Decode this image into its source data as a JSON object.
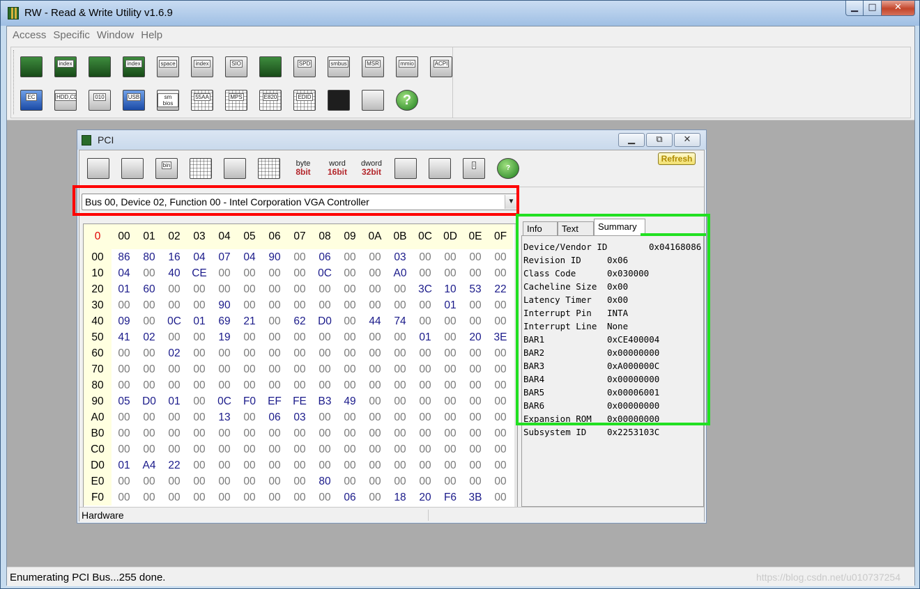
{
  "app": {
    "title": "RW - Read & Write Utility v1.6.9",
    "window_buttons": {
      "minimize": "▁",
      "maximize": "□",
      "close": "✕"
    }
  },
  "menu": [
    "Access",
    "Specific",
    "Window",
    "Help"
  ],
  "toolbar": {
    "row1": [
      {
        "icon": "pci-board-icon",
        "label": ""
      },
      {
        "icon": "pci-index-icon",
        "label": "index"
      },
      {
        "icon": "memory-icon",
        "label": ""
      },
      {
        "icon": "memory-index-icon",
        "label": "index"
      },
      {
        "icon": "io-space-icon",
        "label": "space"
      },
      {
        "icon": "io-index-icon",
        "label": "index"
      },
      {
        "icon": "sio-icon",
        "label": "SIO"
      },
      {
        "icon": "wave-icon",
        "label": ""
      },
      {
        "icon": "spd-icon",
        "label": "SPD"
      },
      {
        "icon": "smbus-icon",
        "label": "smbus"
      },
      {
        "icon": "msr-icon",
        "label": "MSR"
      },
      {
        "icon": "mmio-icon",
        "label": "mmio"
      },
      {
        "icon": "acpi-icon",
        "label": "ACPI"
      }
    ],
    "row2": [
      {
        "icon": "ec-icon",
        "label": "EC"
      },
      {
        "icon": "hdd-cd-icon",
        "label": "HDD,CD"
      },
      {
        "icon": "disk-010-icon",
        "label": "010"
      },
      {
        "icon": "usb-icon",
        "label": "USB"
      },
      {
        "icon": "smbios-icon",
        "label": "sm bios"
      },
      {
        "icon": "55aa-icon",
        "label": "55AA"
      },
      {
        "icon": "mps-icon",
        "label": "MPS"
      },
      {
        "icon": "e820-icon",
        "label": "E820"
      },
      {
        "icon": "edid-icon",
        "label": "EDID"
      },
      {
        "icon": "command-icon",
        "label": ""
      },
      {
        "icon": "device-icon",
        "label": ""
      },
      {
        "icon": "help-icon",
        "label": "?"
      }
    ]
  },
  "pci_window": {
    "title": "PCI",
    "buttons": {
      "minimize": "▁",
      "restore": "⧉",
      "close": "✕"
    },
    "toolbar": [
      {
        "icon": "save-icon",
        "label": ""
      },
      {
        "icon": "save-all-icon",
        "label": ""
      },
      {
        "icon": "save-bin-icon",
        "label": "bin"
      },
      {
        "icon": "load-icon",
        "label": ""
      },
      {
        "icon": "find-icon",
        "label": ""
      },
      {
        "icon": "table-icon",
        "label": ""
      },
      {
        "icon": "byte-8bit-icon",
        "label": "byte",
        "sub": "8bit"
      },
      {
        "icon": "word-16bit-icon",
        "label": "word",
        "sub": "16bit"
      },
      {
        "icon": "dword-32bit-icon",
        "label": "dword",
        "sub": "32bit"
      },
      {
        "icon": "list-icon",
        "label": ""
      },
      {
        "icon": "disabled-icon",
        "label": ""
      },
      {
        "icon": "info-icon",
        "label": "i"
      },
      {
        "icon": "help-icon",
        "label": "?"
      }
    ],
    "refresh_label": "Refresh",
    "device_select": "Bus 00, Device 02, Function 00 - Intel Corporation VGA Controller",
    "hex": {
      "corner": "0",
      "columns": [
        "00",
        "01",
        "02",
        "03",
        "04",
        "05",
        "06",
        "07",
        "08",
        "09",
        "0A",
        "0B",
        "0C",
        "0D",
        "0E",
        "0F"
      ],
      "rows": [
        {
          "addr": "00",
          "bytes": [
            "86",
            "80",
            "16",
            "04",
            "07",
            "04",
            "90",
            "00",
            "06",
            "00",
            "00",
            "03",
            "00",
            "00",
            "00",
            "00"
          ]
        },
        {
          "addr": "10",
          "bytes": [
            "04",
            "00",
            "40",
            "CE",
            "00",
            "00",
            "00",
            "00",
            "0C",
            "00",
            "00",
            "A0",
            "00",
            "00",
            "00",
            "00"
          ]
        },
        {
          "addr": "20",
          "bytes": [
            "01",
            "60",
            "00",
            "00",
            "00",
            "00",
            "00",
            "00",
            "00",
            "00",
            "00",
            "00",
            "3C",
            "10",
            "53",
            "22"
          ]
        },
        {
          "addr": "30",
          "bytes": [
            "00",
            "00",
            "00",
            "00",
            "90",
            "00",
            "00",
            "00",
            "00",
            "00",
            "00",
            "00",
            "00",
            "01",
            "00",
            "00"
          ]
        },
        {
          "addr": "40",
          "bytes": [
            "09",
            "00",
            "0C",
            "01",
            "69",
            "21",
            "00",
            "62",
            "D0",
            "00",
            "44",
            "74",
            "00",
            "00",
            "00",
            "00"
          ]
        },
        {
          "addr": "50",
          "bytes": [
            "41",
            "02",
            "00",
            "00",
            "19",
            "00",
            "00",
            "00",
            "00",
            "00",
            "00",
            "00",
            "01",
            "00",
            "20",
            "3E"
          ]
        },
        {
          "addr": "60",
          "bytes": [
            "00",
            "00",
            "02",
            "00",
            "00",
            "00",
            "00",
            "00",
            "00",
            "00",
            "00",
            "00",
            "00",
            "00",
            "00",
            "00"
          ]
        },
        {
          "addr": "70",
          "bytes": [
            "00",
            "00",
            "00",
            "00",
            "00",
            "00",
            "00",
            "00",
            "00",
            "00",
            "00",
            "00",
            "00",
            "00",
            "00",
            "00"
          ]
        },
        {
          "addr": "80",
          "bytes": [
            "00",
            "00",
            "00",
            "00",
            "00",
            "00",
            "00",
            "00",
            "00",
            "00",
            "00",
            "00",
            "00",
            "00",
            "00",
            "00"
          ]
        },
        {
          "addr": "90",
          "bytes": [
            "05",
            "D0",
            "01",
            "00",
            "0C",
            "F0",
            "EF",
            "FE",
            "B3",
            "49",
            "00",
            "00",
            "00",
            "00",
            "00",
            "00"
          ]
        },
        {
          "addr": "A0",
          "bytes": [
            "00",
            "00",
            "00",
            "00",
            "13",
            "00",
            "06",
            "03",
            "00",
            "00",
            "00",
            "00",
            "00",
            "00",
            "00",
            "00"
          ]
        },
        {
          "addr": "B0",
          "bytes": [
            "00",
            "00",
            "00",
            "00",
            "00",
            "00",
            "00",
            "00",
            "00",
            "00",
            "00",
            "00",
            "00",
            "00",
            "00",
            "00"
          ]
        },
        {
          "addr": "C0",
          "bytes": [
            "00",
            "00",
            "00",
            "00",
            "00",
            "00",
            "00",
            "00",
            "00",
            "00",
            "00",
            "00",
            "00",
            "00",
            "00",
            "00"
          ]
        },
        {
          "addr": "D0",
          "bytes": [
            "01",
            "A4",
            "22",
            "00",
            "00",
            "00",
            "00",
            "00",
            "00",
            "00",
            "00",
            "00",
            "00",
            "00",
            "00",
            "00"
          ]
        },
        {
          "addr": "E0",
          "bytes": [
            "00",
            "00",
            "00",
            "00",
            "00",
            "00",
            "00",
            "00",
            "80",
            "00",
            "00",
            "00",
            "00",
            "00",
            "00",
            "00"
          ]
        },
        {
          "addr": "F0",
          "bytes": [
            "00",
            "00",
            "00",
            "00",
            "00",
            "00",
            "00",
            "00",
            "00",
            "06",
            "00",
            "18",
            "20",
            "F6",
            "3B",
            "00"
          ]
        }
      ]
    },
    "tabs": [
      "Info",
      "Text",
      "Summary"
    ],
    "active_tab": "Summary",
    "summary": [
      {
        "name": "Device/Vendor ID",
        "value": "0x04168086"
      },
      {
        "name": "Revision ID",
        "value": "0x06"
      },
      {
        "name": "Class Code",
        "value": "0x030000"
      },
      {
        "name": "Cacheline Size",
        "value": "0x00"
      },
      {
        "name": "Latency Timer",
        "value": "0x00"
      },
      {
        "name": "Interrupt Pin",
        "value": "INTA"
      },
      {
        "name": "Interrupt Line",
        "value": "None"
      },
      {
        "name": "BAR1",
        "value": "0xCE400004"
      },
      {
        "name": "BAR2",
        "value": "0x00000000"
      },
      {
        "name": "BAR3",
        "value": "0xA000000C"
      },
      {
        "name": "BAR4",
        "value": "0x00000000"
      },
      {
        "name": "BAR5",
        "value": "0x00006001"
      },
      {
        "name": "BAR6",
        "value": "0x00000000"
      },
      {
        "name": "Expansion ROM",
        "value": "0x00000000"
      },
      {
        "name": "Subsystem ID",
        "value": "0x2253103C"
      }
    ],
    "status": "Hardware"
  },
  "statusbar": {
    "text": "Enumerating PCI Bus...255 done.",
    "watermark": "https://blog.csdn.net/u010737254"
  },
  "colors": {
    "highlight_red": "#ff0000",
    "highlight_green": "#22e022",
    "hex_nonzero": "#1a1a8a",
    "hex_zero": "#7a7a7a",
    "header_bg": "#ffffe0"
  }
}
